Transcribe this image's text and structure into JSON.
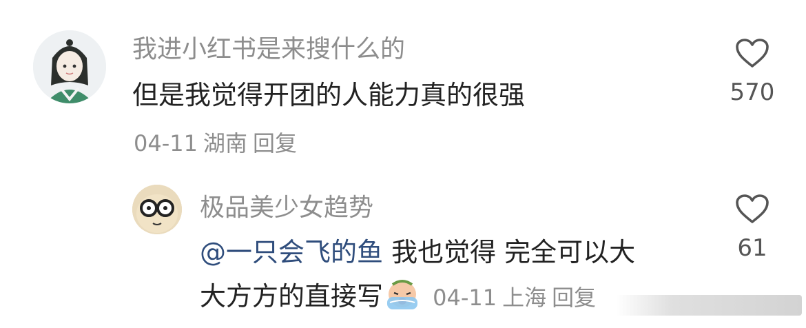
{
  "comments": [
    {
      "username": "我进小红书是来搜什么的",
      "text": "但是我觉得开团的人能力真的很强",
      "date": "04-11",
      "location": "湖南",
      "reply_label": "回复",
      "like_count": "570",
      "avatar_icon": "anime-avatar-icon"
    },
    {
      "username": "极品美少女趋势",
      "mention": "@一只会飞的鱼",
      "text_line1": " 我也觉得 完全可以大",
      "text_line2": "大方方的直接写",
      "emoji": "crying-emoji",
      "date": "04-11",
      "location": "上海",
      "reply_label": "回复",
      "like_count": "61",
      "avatar_icon": "glasses-face-avatar-icon"
    }
  ],
  "colors": {
    "username": "#8d8d8d",
    "content": "#222222",
    "mention": "#2f4d7c",
    "like_icon": "#555555"
  }
}
